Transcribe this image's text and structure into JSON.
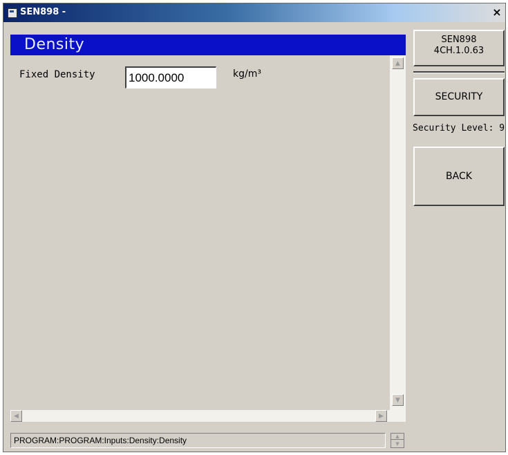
{
  "window": {
    "title": "SEN898 -",
    "close_label": "×"
  },
  "header": {
    "title": "Density"
  },
  "form": {
    "fixed_density_label": "Fixed Density",
    "fixed_density_value": "1000.0000",
    "unit": "kg/m³"
  },
  "status_bar": {
    "path": "PROGRAM:PROGRAM:Inputs:Density:Density"
  },
  "sidebar": {
    "device_name": "SEN898",
    "firmware": "4CH.1.0.63",
    "security_button": "SECURITY",
    "security_level": "Security Level: 9",
    "back_button": "BACK"
  },
  "icons": {
    "app": "app-window-icon",
    "close": "close-icon",
    "scroll_up": "arrow-up-icon",
    "scroll_down": "arrow-down-icon",
    "scroll_left": "arrow-left-icon",
    "scroll_right": "arrow-right-icon"
  },
  "colors": {
    "header_bg": "#0a10c8",
    "window_bg": "#d4d0c8",
    "titlebar_start": "#0a246a"
  }
}
